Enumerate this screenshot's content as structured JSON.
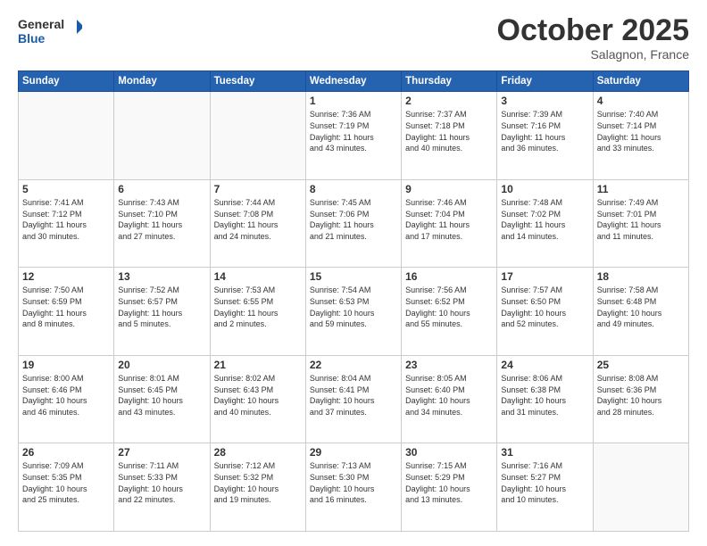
{
  "header": {
    "logo_line1": "General",
    "logo_line2": "Blue",
    "month": "October 2025",
    "location": "Salagnon, France"
  },
  "weekdays": [
    "Sunday",
    "Monday",
    "Tuesday",
    "Wednesday",
    "Thursday",
    "Friday",
    "Saturday"
  ],
  "weeks": [
    [
      {
        "day": "",
        "info": ""
      },
      {
        "day": "",
        "info": ""
      },
      {
        "day": "",
        "info": ""
      },
      {
        "day": "1",
        "info": "Sunrise: 7:36 AM\nSunset: 7:19 PM\nDaylight: 11 hours\nand 43 minutes."
      },
      {
        "day": "2",
        "info": "Sunrise: 7:37 AM\nSunset: 7:18 PM\nDaylight: 11 hours\nand 40 minutes."
      },
      {
        "day": "3",
        "info": "Sunrise: 7:39 AM\nSunset: 7:16 PM\nDaylight: 11 hours\nand 36 minutes."
      },
      {
        "day": "4",
        "info": "Sunrise: 7:40 AM\nSunset: 7:14 PM\nDaylight: 11 hours\nand 33 minutes."
      }
    ],
    [
      {
        "day": "5",
        "info": "Sunrise: 7:41 AM\nSunset: 7:12 PM\nDaylight: 11 hours\nand 30 minutes."
      },
      {
        "day": "6",
        "info": "Sunrise: 7:43 AM\nSunset: 7:10 PM\nDaylight: 11 hours\nand 27 minutes."
      },
      {
        "day": "7",
        "info": "Sunrise: 7:44 AM\nSunset: 7:08 PM\nDaylight: 11 hours\nand 24 minutes."
      },
      {
        "day": "8",
        "info": "Sunrise: 7:45 AM\nSunset: 7:06 PM\nDaylight: 11 hours\nand 21 minutes."
      },
      {
        "day": "9",
        "info": "Sunrise: 7:46 AM\nSunset: 7:04 PM\nDaylight: 11 hours\nand 17 minutes."
      },
      {
        "day": "10",
        "info": "Sunrise: 7:48 AM\nSunset: 7:02 PM\nDaylight: 11 hours\nand 14 minutes."
      },
      {
        "day": "11",
        "info": "Sunrise: 7:49 AM\nSunset: 7:01 PM\nDaylight: 11 hours\nand 11 minutes."
      }
    ],
    [
      {
        "day": "12",
        "info": "Sunrise: 7:50 AM\nSunset: 6:59 PM\nDaylight: 11 hours\nand 8 minutes."
      },
      {
        "day": "13",
        "info": "Sunrise: 7:52 AM\nSunset: 6:57 PM\nDaylight: 11 hours\nand 5 minutes."
      },
      {
        "day": "14",
        "info": "Sunrise: 7:53 AM\nSunset: 6:55 PM\nDaylight: 11 hours\nand 2 minutes."
      },
      {
        "day": "15",
        "info": "Sunrise: 7:54 AM\nSunset: 6:53 PM\nDaylight: 10 hours\nand 59 minutes."
      },
      {
        "day": "16",
        "info": "Sunrise: 7:56 AM\nSunset: 6:52 PM\nDaylight: 10 hours\nand 55 minutes."
      },
      {
        "day": "17",
        "info": "Sunrise: 7:57 AM\nSunset: 6:50 PM\nDaylight: 10 hours\nand 52 minutes."
      },
      {
        "day": "18",
        "info": "Sunrise: 7:58 AM\nSunset: 6:48 PM\nDaylight: 10 hours\nand 49 minutes."
      }
    ],
    [
      {
        "day": "19",
        "info": "Sunrise: 8:00 AM\nSunset: 6:46 PM\nDaylight: 10 hours\nand 46 minutes."
      },
      {
        "day": "20",
        "info": "Sunrise: 8:01 AM\nSunset: 6:45 PM\nDaylight: 10 hours\nand 43 minutes."
      },
      {
        "day": "21",
        "info": "Sunrise: 8:02 AM\nSunset: 6:43 PM\nDaylight: 10 hours\nand 40 minutes."
      },
      {
        "day": "22",
        "info": "Sunrise: 8:04 AM\nSunset: 6:41 PM\nDaylight: 10 hours\nand 37 minutes."
      },
      {
        "day": "23",
        "info": "Sunrise: 8:05 AM\nSunset: 6:40 PM\nDaylight: 10 hours\nand 34 minutes."
      },
      {
        "day": "24",
        "info": "Sunrise: 8:06 AM\nSunset: 6:38 PM\nDaylight: 10 hours\nand 31 minutes."
      },
      {
        "day": "25",
        "info": "Sunrise: 8:08 AM\nSunset: 6:36 PM\nDaylight: 10 hours\nand 28 minutes."
      }
    ],
    [
      {
        "day": "26",
        "info": "Sunrise: 7:09 AM\nSunset: 5:35 PM\nDaylight: 10 hours\nand 25 minutes."
      },
      {
        "day": "27",
        "info": "Sunrise: 7:11 AM\nSunset: 5:33 PM\nDaylight: 10 hours\nand 22 minutes."
      },
      {
        "day": "28",
        "info": "Sunrise: 7:12 AM\nSunset: 5:32 PM\nDaylight: 10 hours\nand 19 minutes."
      },
      {
        "day": "29",
        "info": "Sunrise: 7:13 AM\nSunset: 5:30 PM\nDaylight: 10 hours\nand 16 minutes."
      },
      {
        "day": "30",
        "info": "Sunrise: 7:15 AM\nSunset: 5:29 PM\nDaylight: 10 hours\nand 13 minutes."
      },
      {
        "day": "31",
        "info": "Sunrise: 7:16 AM\nSunset: 5:27 PM\nDaylight: 10 hours\nand 10 minutes."
      },
      {
        "day": "",
        "info": ""
      }
    ]
  ]
}
